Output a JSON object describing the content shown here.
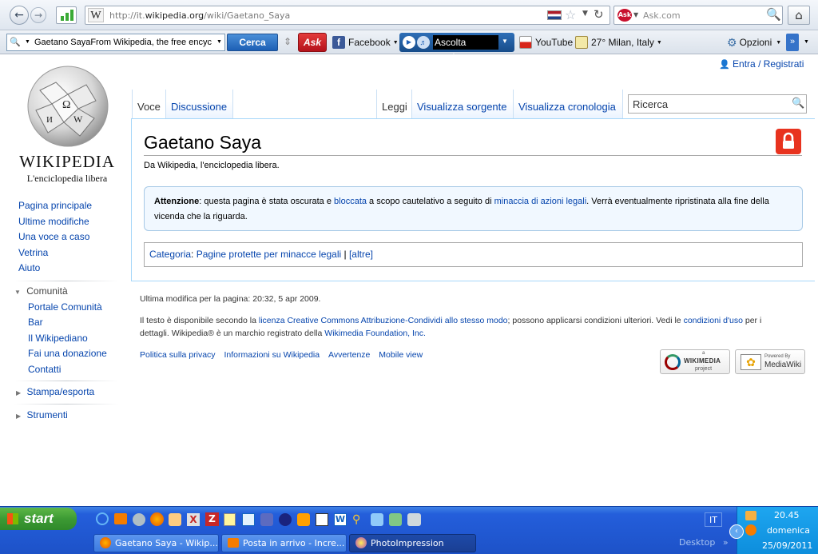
{
  "browser": {
    "url_prefix": "http://it.",
    "url_domain": "wikipedia.org",
    "url_path": "/wiki/Gaetano_Saya",
    "search_placeholder": "Ask.com"
  },
  "toolbar": {
    "search_value": "Gaetano SayaFrom Wikipedia, the free encyc",
    "search_button": "Cerca",
    "facebook": "Facebook",
    "music": "Ascolta musica",
    "youtube": "YouTube",
    "weather": "27° Milan, Italy",
    "options": "Opzioni"
  },
  "wiki": {
    "logo_title": "WIKIPEDIA",
    "logo_subtitle": "L'enciclopedia libera",
    "personal": "Entra / Registrati",
    "nav": [
      "Pagina principale",
      "Ultime modifiche",
      "Una voce a caso",
      "Vetrina",
      "Aiuto"
    ],
    "community_heading": "Comunità",
    "community": [
      "Portale Comunità",
      "Bar",
      "Il Wikipediano",
      "Fai una donazione",
      "Contatti"
    ],
    "print_heading": "Stampa/esporta",
    "tools_heading": "Strumenti",
    "tabs": {
      "voce": "Voce",
      "discussione": "Discussione",
      "leggi": "Leggi",
      "sorgente": "Visualizza sorgente",
      "cronologia": "Visualizza cronologia"
    },
    "search_placeholder": "Ricerca",
    "title": "Gaetano Saya",
    "tagline": "Da Wikipedia, l'enciclopedia libera.",
    "notice": {
      "bold": "Attenzione",
      "t1": ": questa pagina è stata oscurata e ",
      "link1": "bloccata",
      "t2": " a scopo cautelativo a seguito di ",
      "link2": "minaccia di azioni legali",
      "t3": ". Verrà eventualmente ripristinata alla fine della vicenda che la riguarda."
    },
    "category": {
      "label": "Categoria",
      "sep": ": ",
      "link": "Pagine protette per minacce legali",
      "bar": " | ",
      "other": "[altre]"
    },
    "footer": {
      "lastmod": "Ultima modifica per la pagina: 20:32, 5 apr 2009.",
      "lic1": "Il testo è disponibile secondo la ",
      "lic_link": "licenza Creative Commons Attribuzione-Condividi allo stesso modo",
      "lic2": "; possono applicarsi condizioni ulteriori. Vedi le ",
      "terms_link": "condizioni d'uso",
      "lic3": " per i dettagli. Wikipedia® è un marchio registrato della ",
      "wmf_link": "Wikimedia Foundation, Inc.",
      "links": [
        "Politica sulla privacy",
        "Informazioni su Wikipedia",
        "Avvertenze",
        "Mobile view"
      ],
      "wikimedia_small": "a",
      "wikimedia": "WIKIMEDIA",
      "wikimedia_sub": "project",
      "powered": "Powered By",
      "mediawiki": "MediaWiki"
    }
  },
  "taskbar": {
    "start": "start",
    "lang": "IT",
    "desktop": "Desktop",
    "time": "20.45",
    "day": "domenica",
    "date": "25/09/2011",
    "tasks": [
      "Gaetano Saya - Wikip...",
      "Posta in arrivo - Incre...",
      "PhotoImpression"
    ]
  },
  "colors": {
    "tab_border": "#a7d7f9",
    "link": "#0645ad",
    "taskbar": "#245edb",
    "start": "#3c9a34",
    "lock": "#e8331f"
  }
}
